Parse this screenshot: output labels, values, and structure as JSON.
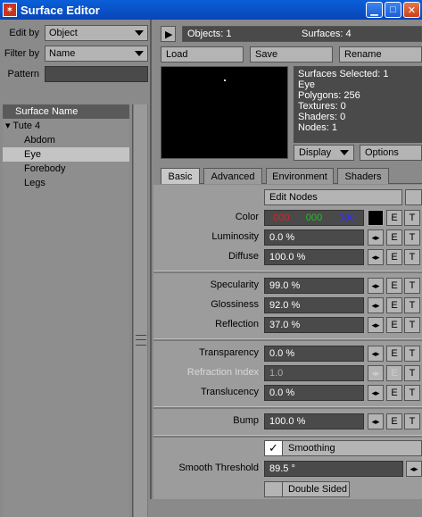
{
  "window": {
    "title": "Surface Editor",
    "app_icon": "lightwave-icon"
  },
  "filters": {
    "edit_by_label": "Edit by",
    "edit_by_value": "Object",
    "filter_by_label": "Filter by",
    "filter_by_value": "Name",
    "pattern_label": "Pattern",
    "pattern_value": ""
  },
  "surface_list": {
    "header": "Surface Name",
    "group": "Tute 4",
    "items": [
      "Abdom",
      "Eye",
      "Forebody",
      "Legs"
    ],
    "selected": "Eye"
  },
  "toolbar": {
    "objects_label": "Objects: 1",
    "surfaces_label": "Surfaces: 4",
    "load": "Load",
    "save": "Save",
    "rename": "Rename"
  },
  "info": {
    "line1": "Surfaces Selected: 1",
    "line2": "Eye",
    "line3": "Polygons: 256",
    "line4": "Textures: 0",
    "line5": "Shaders: 0",
    "line6": "Nodes: 1"
  },
  "preview_controls": {
    "display": "Display",
    "options": "Options"
  },
  "tabs": [
    "Basic",
    "Advanced",
    "Environment",
    "Shaders"
  ],
  "active_tab": "Basic",
  "basic": {
    "edit_nodes": "Edit Nodes",
    "color_label": "Color",
    "color_r": "000",
    "color_g": "000",
    "color_b": "000",
    "luminosity_label": "Luminosity",
    "luminosity": "0.0 %",
    "diffuse_label": "Diffuse",
    "diffuse": "100.0 %",
    "specularity_label": "Specularity",
    "specularity": "99.0 %",
    "glossiness_label": "Glossiness",
    "glossiness": "92.0 %",
    "reflection_label": "Reflection",
    "reflection": "37.0 %",
    "transparency_label": "Transparency",
    "transparency": "0.0 %",
    "refraction_label": "Refraction Index",
    "refraction": "1.0",
    "translucency_label": "Translucency",
    "translucency": "0.0 %",
    "bump_label": "Bump",
    "bump": "100.0 %",
    "smoothing_label": "Smoothing",
    "smoothing_checked": true,
    "smooth_threshold_label": "Smooth Threshold",
    "smooth_threshold": "89.5 °",
    "double_sided_label": "Double Sided"
  },
  "envelope_btn": "E",
  "texture_btn": "T",
  "colors": {
    "red": "#e02020",
    "green": "#20c020",
    "blue": "#3030ff",
    "titlebar": "#0a5fd8"
  }
}
